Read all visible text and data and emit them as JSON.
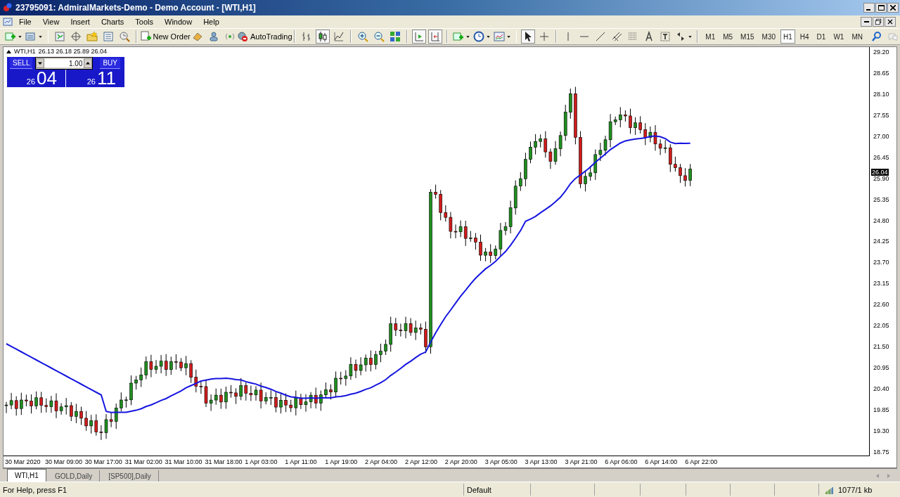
{
  "window": {
    "title": "23795091: AdmiralMarkets-Demo - Demo Account - [WTI,H1]"
  },
  "menu": [
    "File",
    "View",
    "Insert",
    "Charts",
    "Tools",
    "Window",
    "Help"
  ],
  "toolbar": {
    "new_order": "New Order",
    "autotrading": "AutoTrading",
    "timeframes": [
      {
        "label": "M1",
        "selected": false
      },
      {
        "label": "M5",
        "selected": false
      },
      {
        "label": "M15",
        "selected": false
      },
      {
        "label": "M30",
        "selected": false
      },
      {
        "label": "H1",
        "selected": true
      },
      {
        "label": "H4",
        "selected": false
      },
      {
        "label": "D1",
        "selected": false
      },
      {
        "label": "W1",
        "selected": false
      },
      {
        "label": "MN",
        "selected": false
      }
    ]
  },
  "chart": {
    "symbol": "WTI,H1",
    "quote": "26.13 26.18 25.89 26.04",
    "trade_panel": {
      "sell": "SELL",
      "buy": "BUY",
      "volume": "1.00",
      "sell_small": "26",
      "sell_big": "04",
      "buy_small": "26",
      "buy_big": "11"
    },
    "price_labels": [
      "29.20",
      "28.65",
      "28.10",
      "27.55",
      "27.00",
      "26.45",
      "25.90",
      "25.35",
      "24.80",
      "24.25",
      "23.70",
      "23.15",
      "22.60",
      "22.05",
      "21.50",
      "20.95",
      "20.40",
      "19.85",
      "19.30",
      "18.75"
    ],
    "current_price": "26.04",
    "time_labels": [
      "30 Mar 2020",
      "30 Mar 09:00",
      "30 Mar 17:00",
      "31 Mar 02:00",
      "31 Mar 10:00",
      "31 Mar 18:00",
      "1 Apr 03:00",
      "1 Apr 11:00",
      "1 Apr 19:00",
      "2 Apr 04:00",
      "2 Apr 12:00",
      "2 Apr 20:00",
      "3 Apr 05:00",
      "3 Apr 13:00",
      "3 Apr 21:00",
      "6 Apr 06:00",
      "6 Apr 14:00",
      "6 Apr 22:00"
    ]
  },
  "tabs": [
    {
      "label": "WTI,H1",
      "selected": true
    },
    {
      "label": "GOLD,Daily",
      "selected": false
    },
    {
      "label": "[SP500],Daily",
      "selected": false
    }
  ],
  "status_bar": {
    "help": "For Help, press F1",
    "profile": "Default",
    "traffic": "1077/1 kb"
  }
}
